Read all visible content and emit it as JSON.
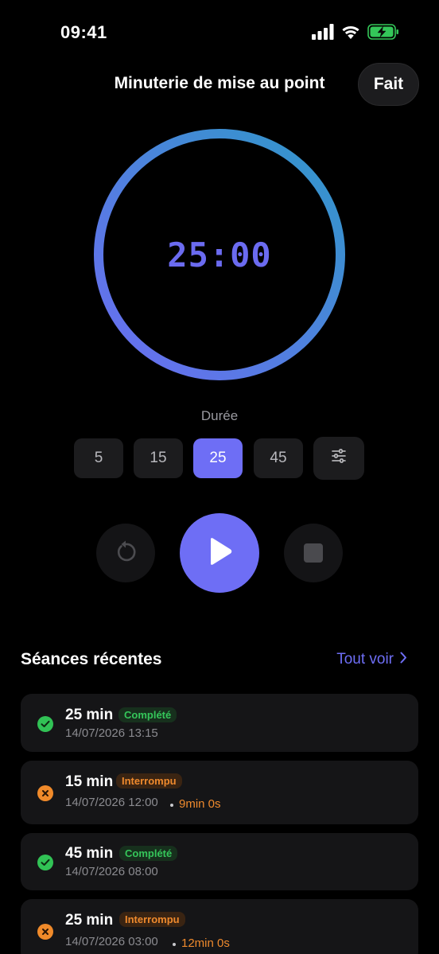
{
  "status_bar": {
    "time": "09:41",
    "icons": [
      "cellular-signal-icon",
      "wifi-icon",
      "battery-charging-icon"
    ],
    "battery_color": "#34c759"
  },
  "header": {
    "title": "Minuterie de mise au point",
    "done_label": "Fait"
  },
  "timer": {
    "display": "25:00",
    "ring_gradient": [
      "#6c6cf2",
      "#2f98c8"
    ]
  },
  "duration": {
    "label": "Durée",
    "presets": [
      "5",
      "15",
      "25",
      "45"
    ],
    "selected": "25",
    "custom_icon": "sliders-icon"
  },
  "controls": {
    "reset_icon": "reset-icon",
    "play_icon": "play-icon",
    "stop_icon": "stop-icon"
  },
  "recent": {
    "title": "Séances récentes",
    "see_all": "Tout voir",
    "sessions": [
      {
        "duration": "25 min",
        "status": "Complété",
        "date": "14/07/2026 13:15",
        "elapsed": ""
      },
      {
        "duration": "15 min",
        "status": "Interrompu",
        "date": "14/07/2026 12:00",
        "elapsed": "9min 0s"
      },
      {
        "duration": "45 min",
        "status": "Complété",
        "date": "14/07/2026 08:00",
        "elapsed": ""
      },
      {
        "duration": "25 min",
        "status": "Interrompu",
        "date": "14/07/2026 03:00",
        "elapsed": "12min 0s"
      }
    ]
  },
  "colors": {
    "accent": "#6e6ef5",
    "completed": "#31c255",
    "interrupted": "#f08a2a",
    "background": "#000000",
    "card": "#151517"
  }
}
